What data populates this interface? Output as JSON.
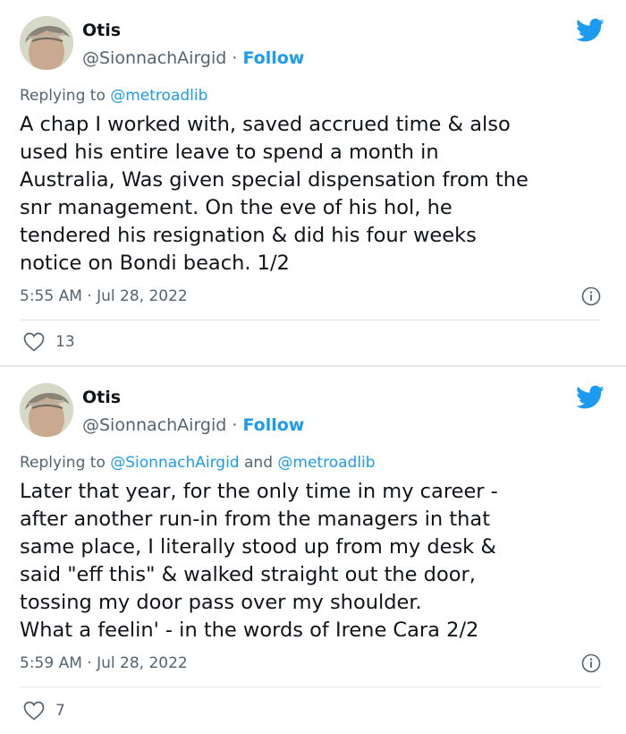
{
  "tweets": [
    {
      "author": {
        "name": "Otis",
        "handle": "@SionnachAirgid",
        "separator": " · ",
        "follow_label": "Follow"
      },
      "replying": {
        "prefix": "Replying to ",
        "mentions": [
          "@metroadlib"
        ],
        "joiner": ""
      },
      "text_lines": [
        "A chap I worked with, saved accrued time & also",
        "used his entire leave to spend a month in",
        "Australia, Was given special dispensation from the",
        "snr management. On the eve of his hol, he",
        "tendered his resignation & did his four weeks",
        "notice on Bondi beach. 1/2"
      ],
      "timestamp": "5:55 AM · Jul 28, 2022",
      "likes": "13",
      "icons": {
        "brand": "twitter-bird-icon",
        "info": "info-icon",
        "like": "heart-icon"
      }
    },
    {
      "author": {
        "name": "Otis",
        "handle": "@SionnachAirgid",
        "separator": " · ",
        "follow_label": "Follow"
      },
      "replying": {
        "prefix": "Replying to ",
        "mentions": [
          "@SionnachAirgid",
          "@metroadlib"
        ],
        "joiner": " and "
      },
      "text_lines": [
        "Later that year, for the only time in my career -",
        "after another run-in from the managers in that",
        "same place, I literally stood up from my desk &",
        "said \"eff this\" & walked straight out the door,",
        "tossing my door pass over my shoulder.",
        "What a feelin' - in the words of Irene Cara 2/2"
      ],
      "timestamp": "5:59 AM · Jul 28, 2022",
      "likes": "7",
      "icons": {
        "brand": "twitter-bird-icon",
        "info": "info-icon",
        "like": "heart-icon"
      }
    }
  ],
  "colors": {
    "accent": "#1d9bf0",
    "secondary_text": "#536471",
    "primary_text": "#0f1419"
  }
}
